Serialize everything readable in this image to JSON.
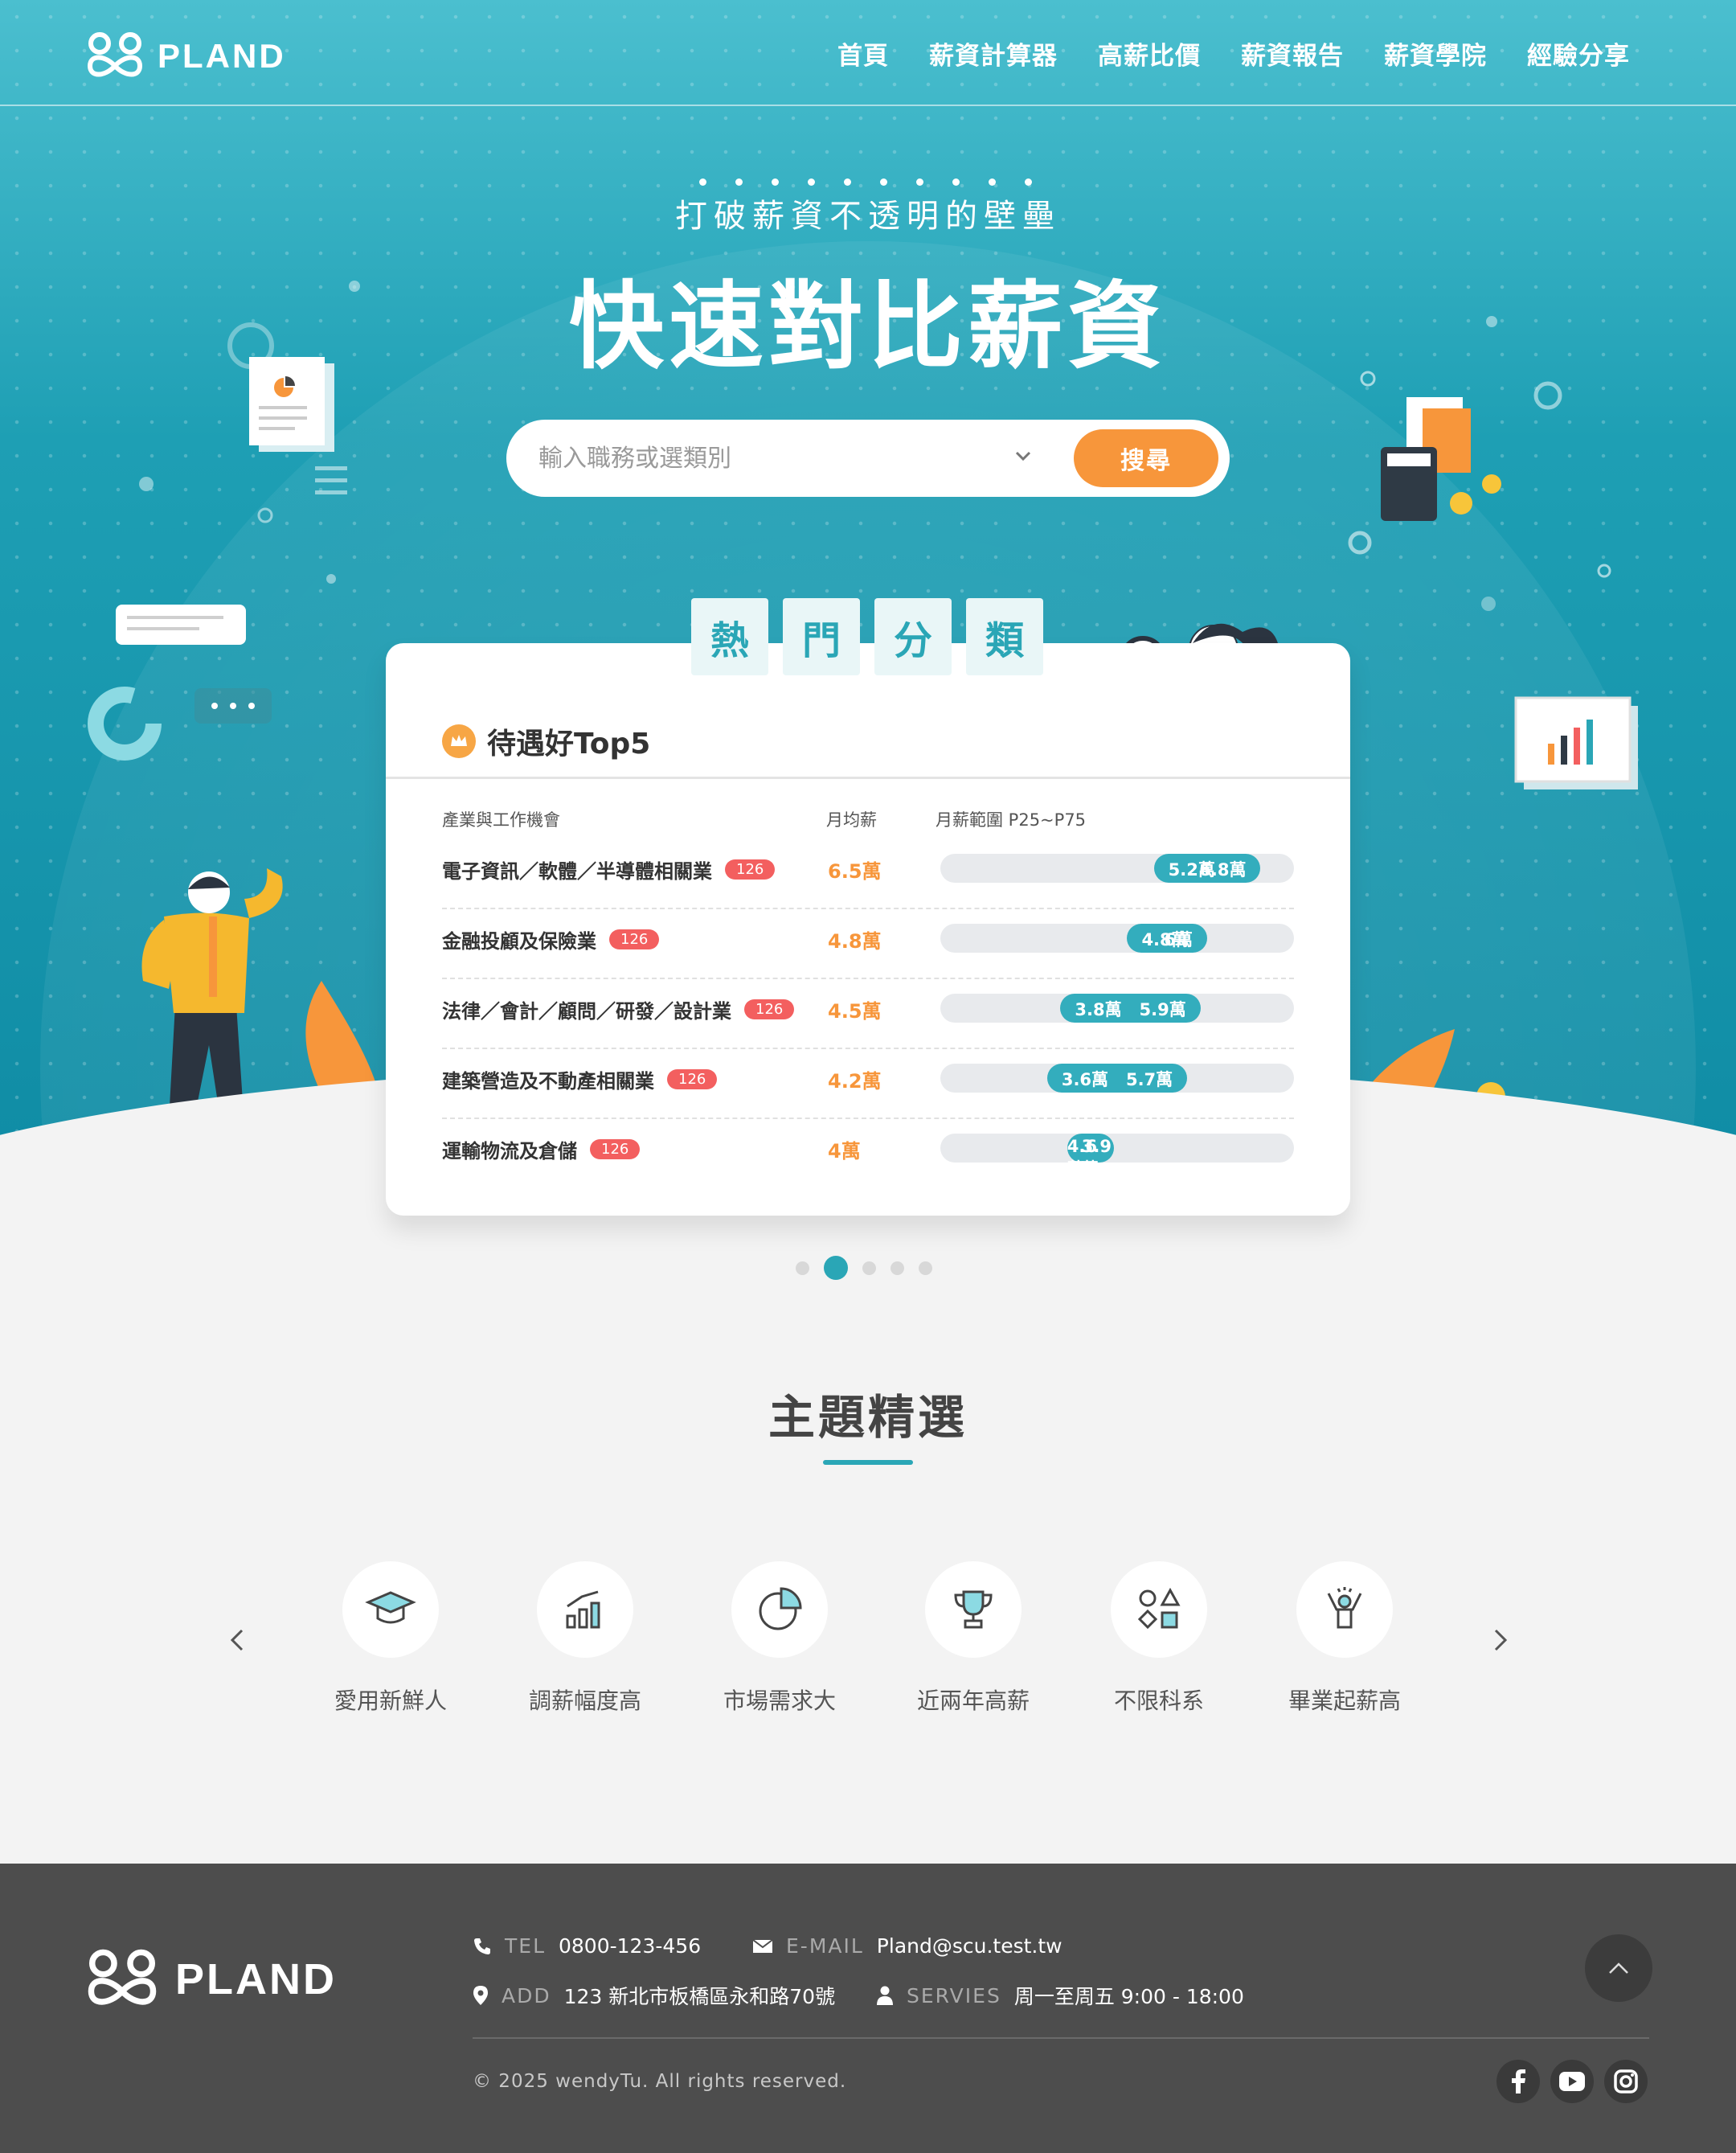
{
  "brand": {
    "name": "PLAND"
  },
  "nav": {
    "items": [
      "首頁",
      "薪資計算器",
      "高薪比價",
      "薪資報告",
      "薪資學院",
      "經驗分享"
    ]
  },
  "hero": {
    "subtitle": "打破薪資不透明的壁壘",
    "title": "快速對比薪資"
  },
  "search": {
    "placeholder": "輸入職務或選類別",
    "button": "搜尋"
  },
  "hot": {
    "tabs": [
      "熱",
      "門",
      "分",
      "類"
    ],
    "card_title": "待遇好Top5",
    "columns": {
      "industry": "產業與工作機會",
      "avg": "月均薪",
      "range": "月薪範圍 P25~P75"
    },
    "rows": [
      {
        "name": "電子資訊／軟體／半導體相關業",
        "count": "126",
        "avg": "6.5萬",
        "p25": "5.2萬",
        "p75": "6.8萬",
        "p25_val": 5.2,
        "p75_val": 6.8
      },
      {
        "name": "金融投顧及保險業",
        "count": "126",
        "avg": "4.8萬",
        "p25": "4.8萬",
        "p75": "6萬",
        "p25_val": 4.8,
        "p75_val": 6.0
      },
      {
        "name": "法律／會計／顧問／研發／設計業",
        "count": "126",
        "avg": "4.5萬",
        "p25": "3.8萬",
        "p75": "5.9萬",
        "p25_val": 3.8,
        "p75_val": 5.9
      },
      {
        "name": "建築營造及不動產相關業",
        "count": "126",
        "avg": "4.2萬",
        "p25": "3.6萬",
        "p75": "5.7萬",
        "p25_val": 3.6,
        "p75_val": 5.7
      },
      {
        "name": "運輸物流及倉儲",
        "count": "126",
        "avg": "4萬",
        "p25": "3.9萬",
        "p75": "4.6萬",
        "p25_val": 3.9,
        "p75_val": 4.6
      }
    ],
    "pager": {
      "count": 5,
      "active": 2
    }
  },
  "themes": {
    "title": "主題精選",
    "items": [
      {
        "label": "愛用新鮮人",
        "icon": "graduation-cap-icon"
      },
      {
        "label": "調薪幅度高",
        "icon": "bar-growth-icon"
      },
      {
        "label": "市場需求大",
        "icon": "pie-chart-icon"
      },
      {
        "label": "近兩年高薪",
        "icon": "trophy-icon"
      },
      {
        "label": "不限科系",
        "icon": "shapes-icon"
      },
      {
        "label": "畢業起薪高",
        "icon": "cheering-person-icon"
      }
    ]
  },
  "footer": {
    "tel_label": "TEL",
    "tel": "0800-123-456",
    "email_label": "E-MAIL",
    "email": "Pland@scu.test.tw",
    "add_label": "ADD",
    "add": "123 新北市板橋區永和路70號",
    "service_label": "SERVIES",
    "service": "周一至周五 9:00 - 18:00",
    "copyright": "© 2025  wendyTu. All rights reserved."
  },
  "colors": {
    "teal": "#2aa6b6",
    "orange": "#f7963b",
    "badge": "#f35f5f",
    "footer": "#4d4d4d"
  }
}
